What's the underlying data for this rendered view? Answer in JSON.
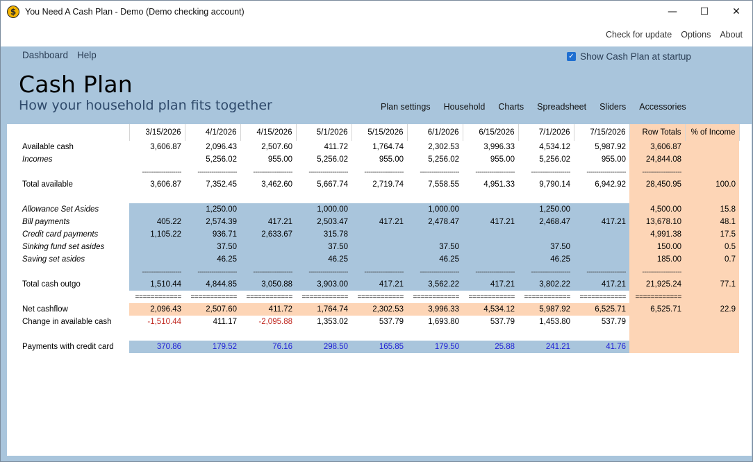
{
  "window": {
    "title": "You Need A Cash Plan - Demo (Demo checking account)",
    "app_icon": "$",
    "controls": [
      "—",
      "☐",
      "✕"
    ]
  },
  "topbar": {
    "links": [
      "Check for update",
      "Options",
      "About"
    ]
  },
  "menu": {
    "items": [
      "Dashboard",
      "Help"
    ]
  },
  "startup": {
    "label": "Show Cash Plan at startup",
    "checked": true
  },
  "page": {
    "title": "Cash Plan",
    "subtitle": "How your household plan fits together"
  },
  "tabs": [
    "Plan settings",
    "Household",
    "Charts",
    "Spreadsheet",
    "Sliders",
    "Accessories"
  ],
  "colors": {
    "blue_band": "#a9c5dc",
    "peach_band": "#fdd5b6",
    "negative": "#c0271f",
    "credit_card": "#1f1fd6"
  },
  "table": {
    "columns": [
      "3/15/2026",
      "4/1/2026",
      "4/15/2026",
      "5/1/2026",
      "5/15/2026",
      "6/1/2026",
      "6/15/2026",
      "7/1/2026",
      "7/15/2026",
      "Row Totals",
      "% of Income"
    ],
    "single_separator": "--------------------",
    "double_separator": "============",
    "rows": [
      {
        "label": "Available cash",
        "style": "plain",
        "values": [
          "3,606.87",
          "2,096.43",
          "2,507.60",
          "411.72",
          "1,764.74",
          "2,302.53",
          "3,996.33",
          "4,534.12",
          "5,987.92",
          "3,606.87",
          ""
        ]
      },
      {
        "label": "Incomes",
        "style": "italic",
        "values": [
          "",
          "5,256.02",
          "955.00",
          "5,256.02",
          "955.00",
          "5,256.02",
          "955.00",
          "5,256.02",
          "955.00",
          "24,844.08",
          ""
        ]
      },
      {
        "label": "",
        "style": "dash",
        "values": [
          "",
          "",
          "",
          "",
          "",
          "",
          "",
          "",
          "",
          "",
          ""
        ]
      },
      {
        "label": "Total available",
        "style": "plain",
        "values": [
          "3,606.87",
          "7,352.45",
          "3,462.60",
          "5,667.74",
          "2,719.74",
          "7,558.55",
          "4,951.33",
          "9,790.14",
          "6,942.92",
          "28,450.95",
          "100.0"
        ]
      },
      {
        "label": "",
        "style": "spacer",
        "values": [
          "",
          "",
          "",
          "",
          "",
          "",
          "",
          "",
          "",
          "",
          ""
        ]
      },
      {
        "label": "Allowance Set Asides",
        "style": "italic-blue",
        "values": [
          "",
          "1,250.00",
          "",
          "1,000.00",
          "",
          "1,000.00",
          "",
          "1,250.00",
          "",
          "4,500.00",
          "15.8"
        ]
      },
      {
        "label": "Bill payments",
        "style": "italic-blue",
        "values": [
          "405.22",
          "2,574.39",
          "417.21",
          "2,503.47",
          "417.21",
          "2,478.47",
          "417.21",
          "2,468.47",
          "417.21",
          "13,678.10",
          "48.1"
        ]
      },
      {
        "label": "Credit card payments",
        "style": "italic-blue",
        "values": [
          "1,105.22",
          "936.71",
          "2,633.67",
          "315.78",
          "",
          "",
          "",
          "",
          "",
          "4,991.38",
          "17.5"
        ]
      },
      {
        "label": "Sinking fund set asides",
        "style": "italic-blue",
        "values": [
          "",
          "37.50",
          "",
          "37.50",
          "",
          "37.50",
          "",
          "37.50",
          "",
          "150.00",
          "0.5"
        ]
      },
      {
        "label": "Saving set asides",
        "style": "italic-blue",
        "values": [
          "",
          "46.25",
          "",
          "46.25",
          "",
          "46.25",
          "",
          "46.25",
          "",
          "185.00",
          "0.7"
        ]
      },
      {
        "label": "",
        "style": "dash-blue",
        "values": [
          "",
          "",
          "",
          "",
          "",
          "",
          "",
          "",
          "",
          "",
          ""
        ]
      },
      {
        "label": "Total cash outgo",
        "style": "plain-blue",
        "values": [
          "1,510.44",
          "4,844.85",
          "3,050.88",
          "3,903.00",
          "417.21",
          "3,562.22",
          "417.21",
          "3,802.22",
          "417.21",
          "21,925.24",
          "77.1"
        ]
      },
      {
        "label": "",
        "style": "double",
        "values": [
          "",
          "",
          "",
          "",
          "",
          "",
          "",
          "",
          "",
          "",
          ""
        ]
      },
      {
        "label": "Net cashflow",
        "style": "plain-peach",
        "values": [
          "2,096.43",
          "2,507.60",
          "411.72",
          "1,764.74",
          "2,302.53",
          "3,996.33",
          "4,534.12",
          "5,987.92",
          "6,525.71",
          "6,525.71",
          "22.9"
        ]
      },
      {
        "label": "Change in available cash",
        "style": "change",
        "values": [
          "-1,510.44",
          "411.17",
          "-2,095.88",
          "1,353.02",
          "537.79",
          "1,693.80",
          "537.79",
          "1,453.80",
          "537.79",
          "",
          ""
        ]
      },
      {
        "label": "",
        "style": "spacer",
        "values": [
          "",
          "",
          "",
          "",
          "",
          "",
          "",
          "",
          "",
          "",
          ""
        ]
      },
      {
        "label": "Payments with credit card",
        "style": "cc-blue",
        "values": [
          "370.86",
          "179.52",
          "76.16",
          "298.50",
          "165.85",
          "179.50",
          "25.88",
          "241.21",
          "41.76",
          "",
          ""
        ]
      }
    ]
  }
}
